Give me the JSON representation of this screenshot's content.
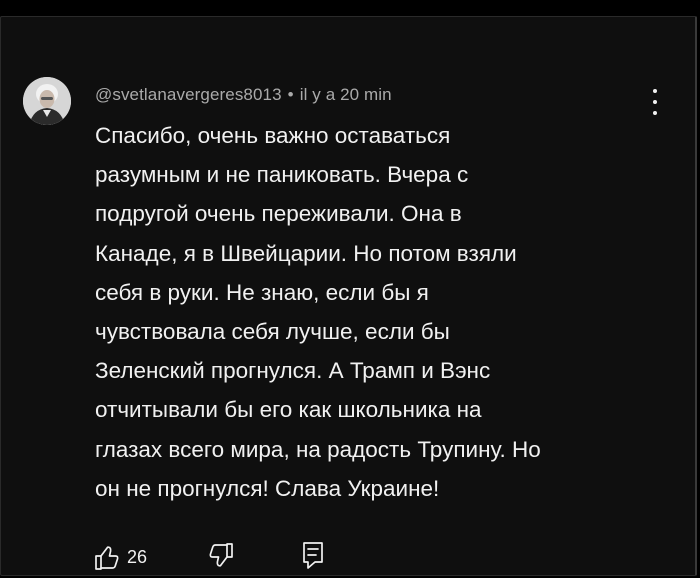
{
  "comment": {
    "author": "@svetlanavergeres8013",
    "separator": "•",
    "timestamp": "il y a 20 min",
    "text_lines": [
      "Спасибо, очень важно оставаться",
      "разумным и не паниковать. Вчера с",
      "подругой очень переживали. Она в",
      "Канаде, я в Швейцарии. Но потом взяли",
      "себя в руки. Не знаю, если бы я",
      "чувствовала себя лучше, если бы",
      "Зеленский прогнулся. А Трамп и Вэнс",
      "отчитывали бы его как школьника на",
      "глазах всего мира, на радость Трупину. Но",
      "он не прогнулся! Слава Украине!"
    ],
    "like_count": "26"
  },
  "icons": {
    "avatar": "avatar",
    "more": "more-vertical-icon",
    "like": "thumbs-up-icon",
    "dislike": "thumbs-down-icon",
    "reply": "reply-icon"
  },
  "colors": {
    "background": "#0f0f0f",
    "text": "#f1f1f1",
    "meta_text": "#aaaaaa"
  }
}
